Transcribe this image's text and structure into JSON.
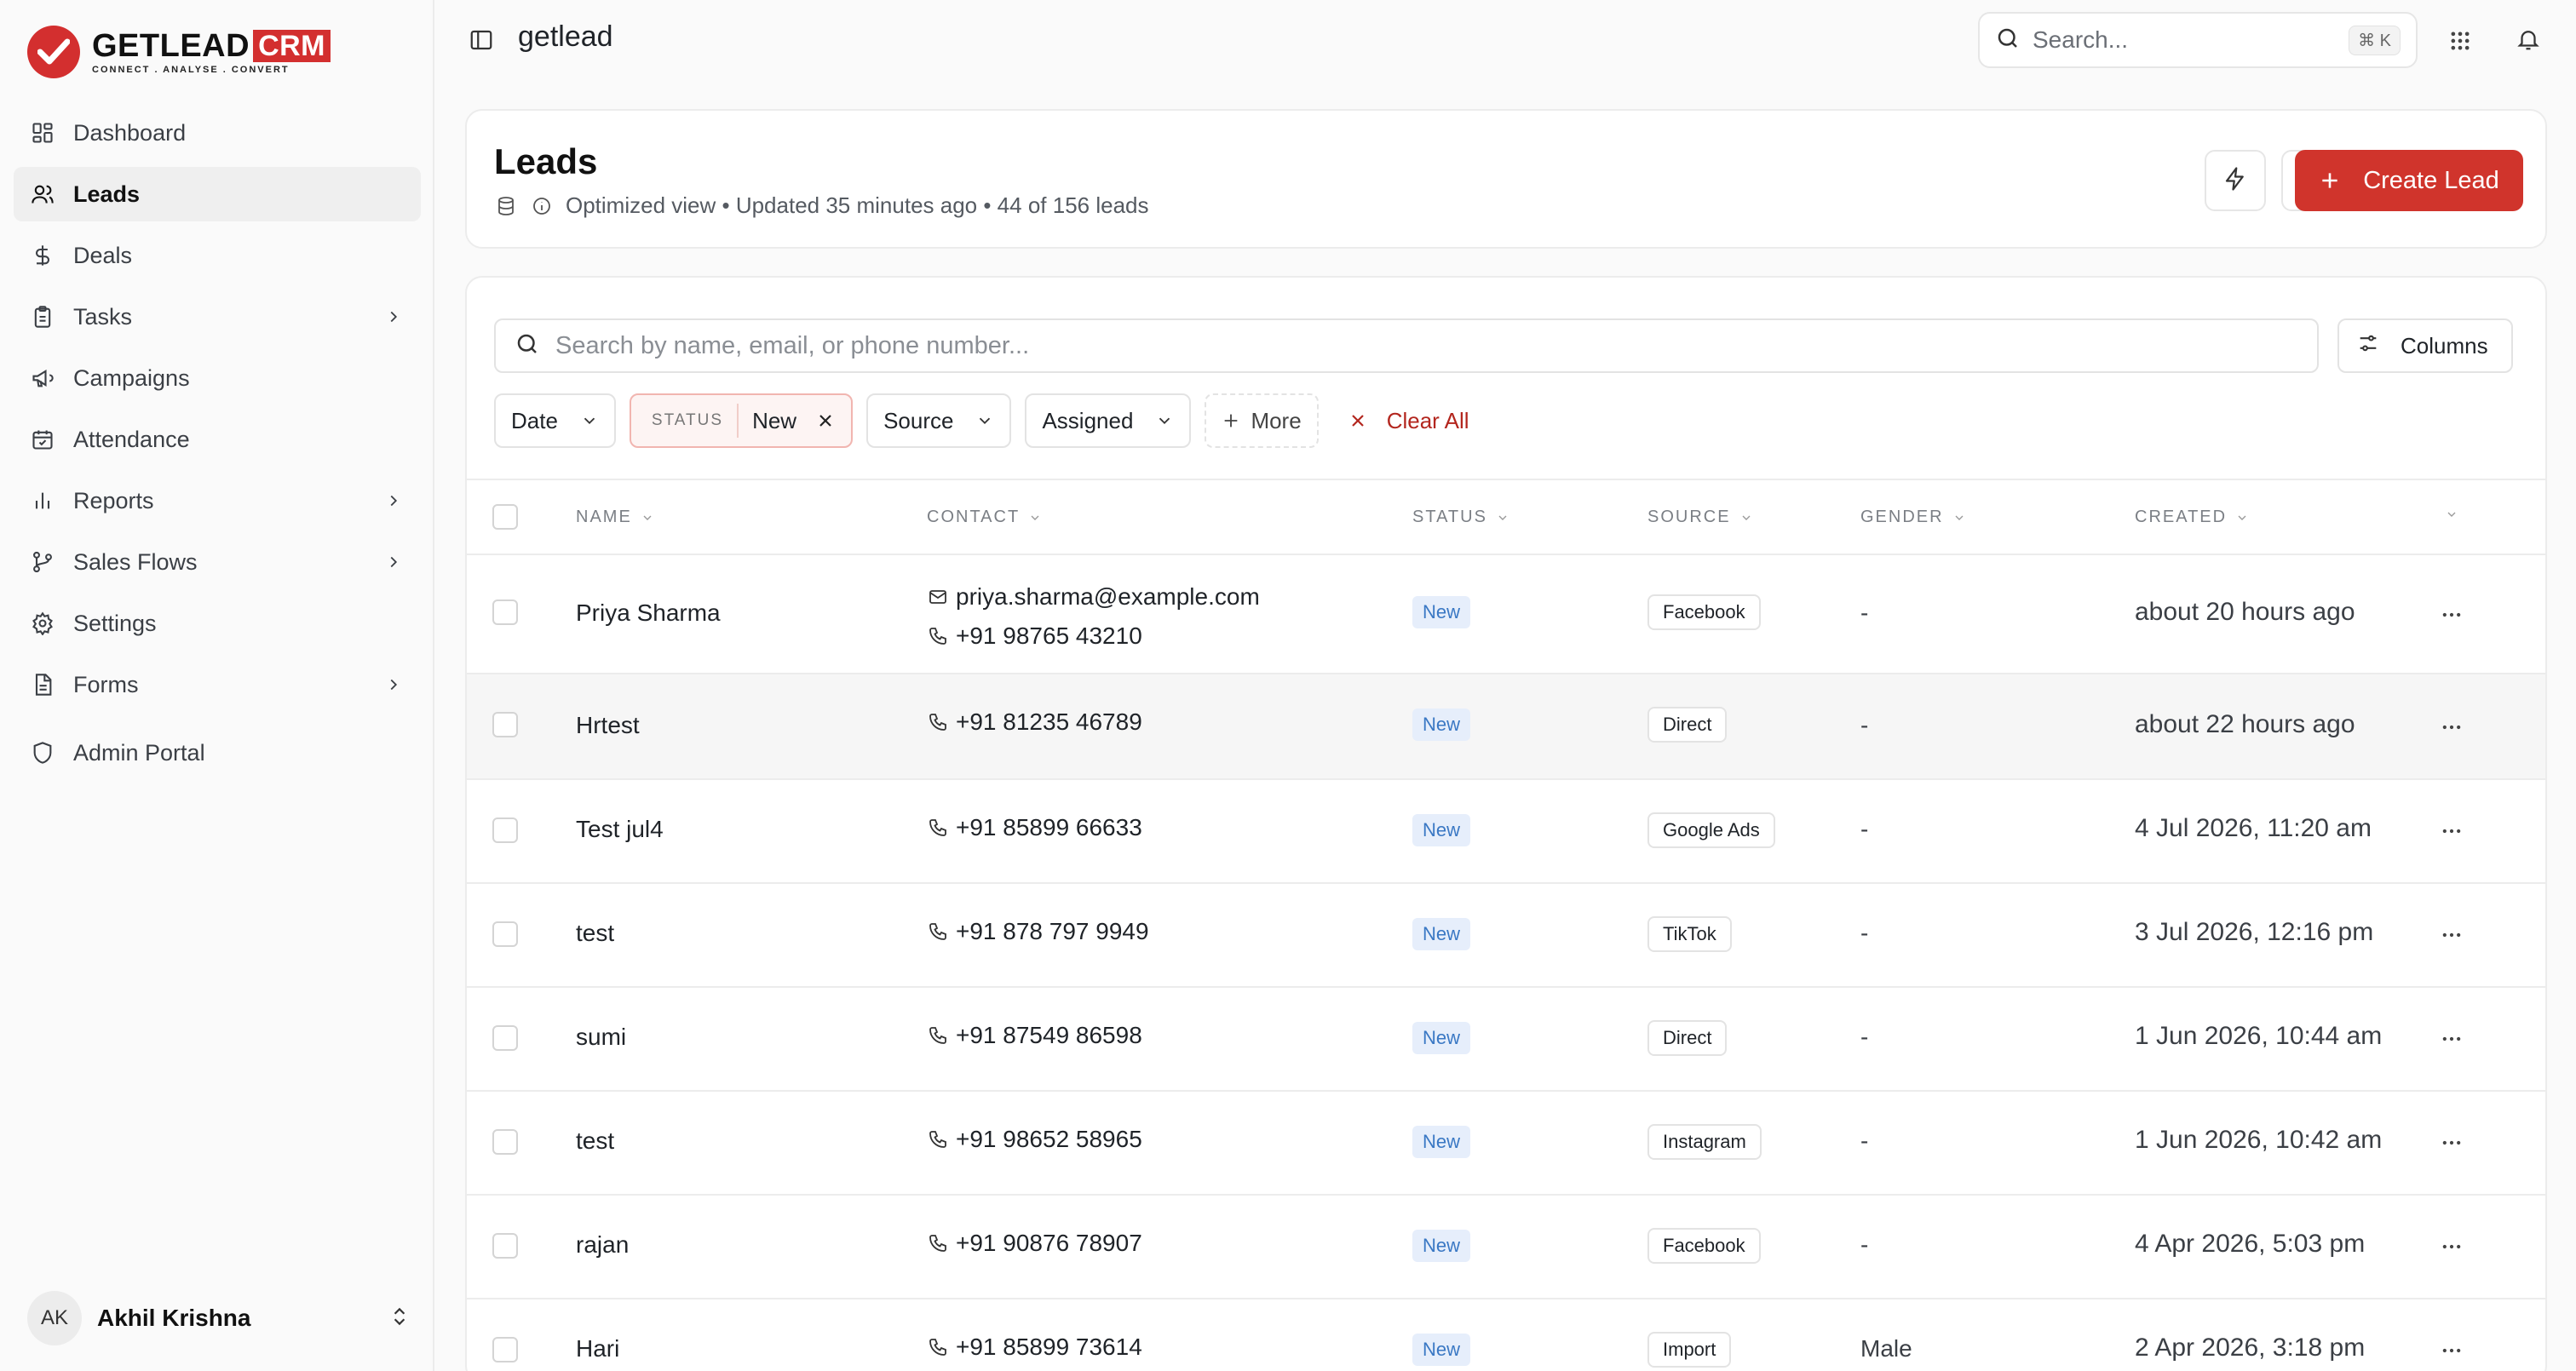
{
  "brand": {
    "name": "GETLEAD",
    "suffix": "CRM",
    "tagline": "CONNECT . ANALYSE . CONVERT"
  },
  "sidebar": {
    "items": [
      {
        "label": "Dashboard",
        "icon": "grid-icon",
        "has_submenu": false
      },
      {
        "label": "Leads",
        "icon": "users-icon",
        "has_submenu": false,
        "active": true
      },
      {
        "label": "Deals",
        "icon": "dollar-icon",
        "has_submenu": false
      },
      {
        "label": "Tasks",
        "icon": "clipboard-icon",
        "has_submenu": true
      },
      {
        "label": "Campaigns",
        "icon": "megaphone-icon",
        "has_submenu": false
      },
      {
        "label": "Attendance",
        "icon": "calendar-check-icon",
        "has_submenu": false
      },
      {
        "label": "Reports",
        "icon": "bar-chart-icon",
        "has_submenu": true
      },
      {
        "label": "Sales Flows",
        "icon": "git-branch-icon",
        "has_submenu": true
      },
      {
        "label": "Settings",
        "icon": "gear-icon",
        "has_submenu": false
      },
      {
        "label": "Forms",
        "icon": "document-icon",
        "has_submenu": true
      }
    ],
    "admin": {
      "label": "Admin Portal",
      "icon": "shield-icon"
    },
    "user": {
      "initials": "AK",
      "name": "Akhil Krishna"
    }
  },
  "topbar": {
    "workspace": "getlead",
    "search_placeholder": "Search...",
    "search_shortcut": "⌘ K"
  },
  "header": {
    "title": "Leads",
    "meta": "Optimized view • Updated 35 minutes ago • 44 of 156 leads",
    "create_label": "Create Lead"
  },
  "toolbar": {
    "search_placeholder": "Search by name, email, or phone number...",
    "columns_label": "Columns"
  },
  "filters": {
    "date": "Date",
    "status_key": "STATUS",
    "status_value": "New",
    "source": "Source",
    "assigned": "Assigned",
    "more": "More",
    "clear_all": "Clear All"
  },
  "table": {
    "columns": [
      "NAME",
      "CONTACT",
      "STATUS",
      "SOURCE",
      "GENDER",
      "CREATED"
    ],
    "rows": [
      {
        "name": "Priya Sharma",
        "email": "priya.sharma@example.com",
        "phone": "+91 98765 43210",
        "status": "New",
        "source": "Facebook",
        "gender": "-",
        "created": "about 20 hours ago"
      },
      {
        "name": "Hrtest",
        "email": "",
        "phone": "+91 81235 46789",
        "status": "New",
        "source": "Direct",
        "gender": "-",
        "created": "about 22 hours ago"
      },
      {
        "name": "Test jul4",
        "email": "",
        "phone": "+91 85899 66633",
        "status": "New",
        "source": "Google Ads",
        "gender": "-",
        "created": "4 Jul 2026, 11:20 am"
      },
      {
        "name": "test",
        "email": "",
        "phone": "+91 878 797 9949",
        "status": "New",
        "source": "TikTok",
        "gender": "-",
        "created": "3 Jul 2026, 12:16 pm"
      },
      {
        "name": "sumi",
        "email": "",
        "phone": "+91 87549 86598",
        "status": "New",
        "source": "Direct",
        "gender": "-",
        "created": "1 Jun 2026, 10:44 am"
      },
      {
        "name": "test",
        "email": "",
        "phone": "+91 98652 58965",
        "status": "New",
        "source": "Instagram",
        "gender": "-",
        "created": "1 Jun 2026, 10:42 am"
      },
      {
        "name": "rajan",
        "email": "",
        "phone": "+91 90876 78907",
        "status": "New",
        "source": "Facebook",
        "gender": "-",
        "created": "4 Apr 2026, 5:03 pm"
      },
      {
        "name": "Hari",
        "email": "",
        "phone": "+91 85899 73614",
        "status": "New",
        "source": "Import",
        "gender": "Male",
        "created": "2 Apr 2026, 3:18 pm"
      }
    ]
  },
  "colors": {
    "brand": "#d32f2f",
    "create_button": "#d0342c",
    "status_badge_bg": "#e6eefb",
    "status_badge_text": "#3a78c4",
    "clear_all": "#b3261e"
  }
}
